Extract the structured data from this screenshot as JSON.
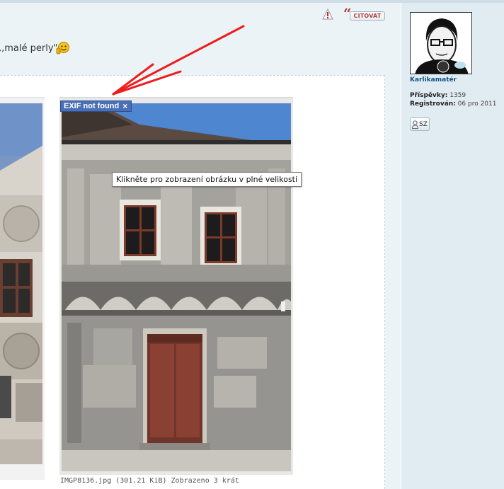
{
  "post": {
    "text": ",,malé perly\"",
    "buttons": {
      "report_icon": "report-exclamation-icon",
      "quote_marks": "“",
      "quote_label": "CITOVAT"
    },
    "smiley_icon": "smiley-face-icon"
  },
  "attachment": {
    "exif_label": "EXIF not found",
    "exif_close": "×",
    "tooltip": "Klikněte pro zobrazení obrázku v plné velikosti",
    "caption": "IMGP8136.jpg (301.21 KiB) Zobrazeno 3 krát"
  },
  "profile": {
    "username": "Karlikamatér",
    "posts_label": "Příspěvky:",
    "posts_value": "1359",
    "registered_label": "Registrován:",
    "registered_value": "06 pro 2011",
    "pm_label": "SZ",
    "pm_icon": "user-message-icon"
  },
  "colors": {
    "post_bg": "#ecf3f7",
    "profile_bg": "#e1ebf2",
    "exif_badge": "#4b6fb3",
    "quote_red": "#b43c3c",
    "username_blue": "#105289",
    "arrow_red": "#ee1c1c"
  }
}
